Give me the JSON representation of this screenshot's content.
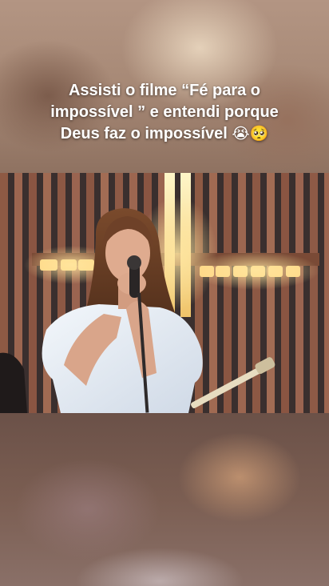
{
  "post": {
    "caption_text": "Assisti o filme “Fé para o impossível ” e entendi porque Deus faz o impossível",
    "caption_emojis": "😭🥺"
  },
  "video": {
    "description_icon": "video-frame",
    "colors": {
      "slats_dark": "#3b3030",
      "slats_light": "#a2644a",
      "light_warm": "#f6d27e",
      "shirt": "#e8eef4",
      "hair": "#6b3f26",
      "skin": "#d9a58a"
    }
  }
}
